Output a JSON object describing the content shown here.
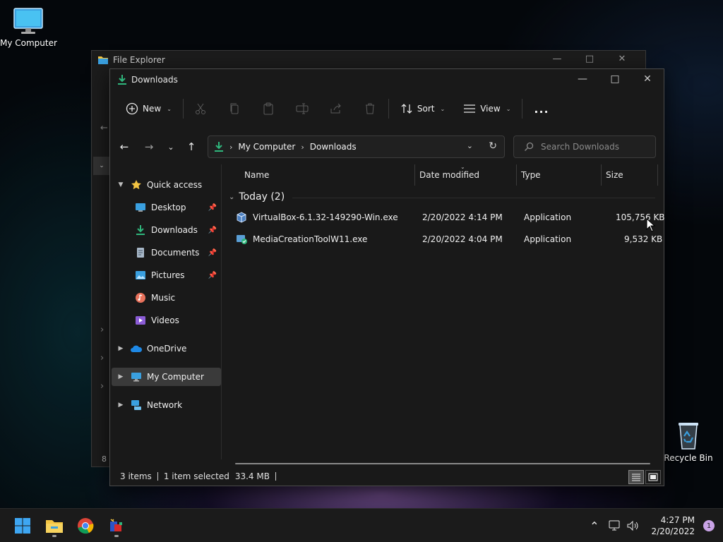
{
  "desktop": {
    "icons": [
      {
        "label": "My Computer"
      },
      {
        "label": "Recycle Bin"
      }
    ]
  },
  "bg_window": {
    "title": "File Explorer",
    "status": "8 i"
  },
  "window": {
    "title": "Downloads",
    "toolbar": {
      "new_label": "New",
      "sort_label": "Sort",
      "view_label": "View",
      "more_label": "..."
    },
    "address": {
      "crumbs": [
        "My Computer",
        "Downloads"
      ]
    },
    "search": {
      "placeholder": "Search Downloads"
    },
    "nav": {
      "quick_access": "Quick access",
      "desktop": "Desktop",
      "downloads": "Downloads",
      "documents": "Documents",
      "pictures": "Pictures",
      "music": "Music",
      "videos": "Videos",
      "onedrive": "OneDrive",
      "my_computer": "My Computer",
      "network": "Network"
    },
    "columns": {
      "name": "Name",
      "date": "Date modified",
      "type": "Type",
      "size": "Size"
    },
    "group": {
      "label": "Today (2)"
    },
    "files": [
      {
        "name": "VirtualBox-6.1.32-149290-Win.exe",
        "date": "2/20/2022 4:14 PM",
        "type": "Application",
        "size": "105,756 KB"
      },
      {
        "name": "MediaCreationToolW11.exe",
        "date": "2/20/2022 4:04 PM",
        "type": "Application",
        "size": "9,532 KB"
      }
    ],
    "status": {
      "items": "3 items",
      "selected": "1 item selected",
      "size": "33.4 MB"
    }
  },
  "taskbar": {
    "time": "4:27 PM",
    "date": "2/20/2022",
    "notifications": "1"
  },
  "colors": {
    "accent_green": "#2fb67c",
    "folder_yellow": "#f4c542",
    "monitor_blue": "#3aa0e0"
  }
}
